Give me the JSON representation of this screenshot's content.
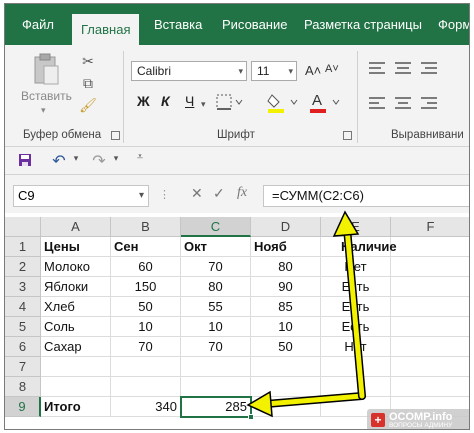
{
  "tabs": [
    "Файл",
    "Главная",
    "Вставка",
    "Рисование",
    "Разметка страницы",
    "Форм"
  ],
  "active_tab": "Главная",
  "ribbon": {
    "clipboard": {
      "paste_label": "Вставить",
      "group_label": "Буфер обмена"
    },
    "font": {
      "font_name": "Calibri",
      "font_size": "11",
      "bold": "Ж",
      "italic": "К",
      "underline": "Ч",
      "grow": "A˄",
      "shrink": "A˅",
      "group_label": "Шрифт"
    },
    "alignment": {
      "group_label": "Выравнивани"
    }
  },
  "formula_bar": {
    "name_box": "C9",
    "cancel_icon": "✕",
    "enter_icon": "✓",
    "fx_label": "fx",
    "formula": "=СУММ(C2:C6)"
  },
  "columns": [
    "A",
    "B",
    "C",
    "D",
    "E",
    "F"
  ],
  "rows": [
    "1",
    "2",
    "3",
    "4",
    "5",
    "6",
    "7",
    "8",
    "9"
  ],
  "header_row": {
    "a": "Цены",
    "b": "Сен",
    "c": "Окт",
    "d": "Нояб",
    "e": "Наличие"
  },
  "products": [
    {
      "name": "Молоко",
      "sep": "60",
      "okt": "70",
      "nov": "80",
      "stock": "Нет"
    },
    {
      "name": "Яблоки",
      "sep": "150",
      "okt": "80",
      "nov": "90",
      "stock": "Есть"
    },
    {
      "name": "Хлеб",
      "sep": "50",
      "okt": "55",
      "nov": "85",
      "stock": "Есть"
    },
    {
      "name": "Соль",
      "sep": "10",
      "okt": "10",
      "nov": "10",
      "stock": "Есть"
    },
    {
      "name": "Сахар",
      "sep": "70",
      "okt": "70",
      "nov": "50",
      "stock": "Нет"
    }
  ],
  "total_row": {
    "label": "Итого",
    "b": "340",
    "c": "285"
  },
  "watermark": {
    "site": "OCOMP.info",
    "tagline": "ВОПРОСЫ АДМИНУ"
  },
  "colors": {
    "excel_green": "#217346",
    "arrow_yellow": "#f2f200",
    "ribbon_bg": "#f3f3f3"
  }
}
